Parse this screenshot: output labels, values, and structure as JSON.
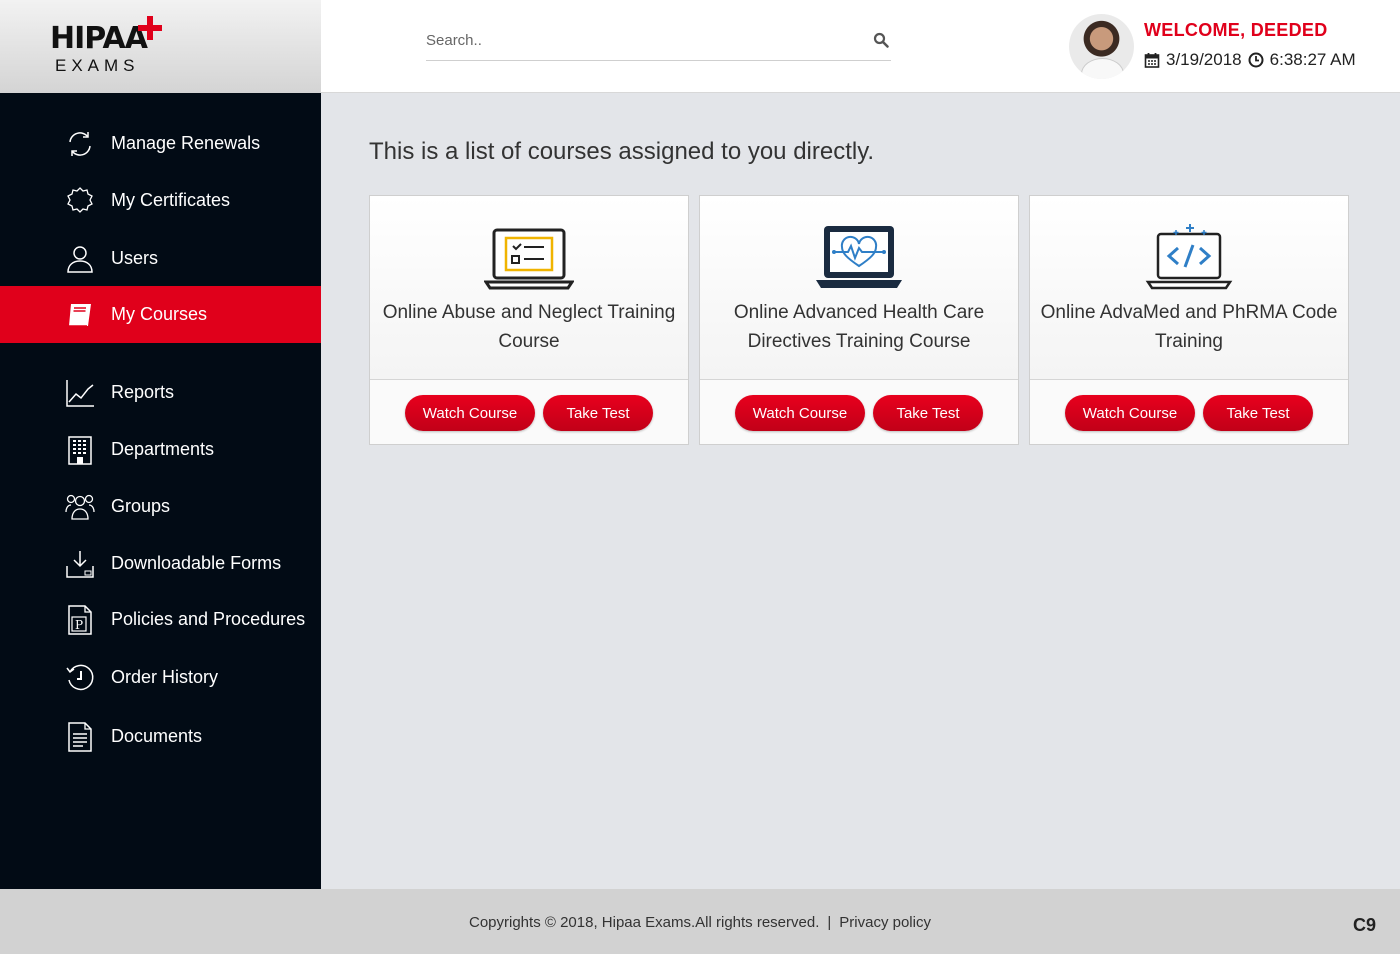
{
  "brand": {
    "name_top": "HIPAA",
    "name_bottom": "EXAMS",
    "accent": "#e0001b"
  },
  "search": {
    "placeholder": "Search.."
  },
  "user": {
    "welcome": "WELCOME, DEEDED",
    "date": "3/19/2018",
    "time": "6:38:27 AM"
  },
  "sidebar": {
    "items": [
      {
        "label": "Manage Renewals",
        "icon": "refresh-icon"
      },
      {
        "label": "My Certificates",
        "icon": "certificate-icon"
      },
      {
        "label": "Users",
        "icon": "user-icon"
      },
      {
        "label": "My Courses",
        "icon": "book-icon",
        "active": true
      },
      {
        "label": "Reports",
        "icon": "chart-icon"
      },
      {
        "label": "Departments",
        "icon": "building-icon"
      },
      {
        "label": "Groups",
        "icon": "group-icon"
      },
      {
        "label": "Downloadable Forms",
        "icon": "download-icon"
      },
      {
        "label": "Policies and Procedures",
        "icon": "policy-document-icon"
      },
      {
        "label": "Order History",
        "icon": "history-icon"
      },
      {
        "label": "Documents",
        "icon": "document-icon"
      }
    ]
  },
  "main": {
    "title": "This is a list of courses assigned to you directly.",
    "courses": [
      {
        "title": "Online Abuse and Neglect Training Course",
        "icon": "laptop-checklist-icon",
        "watch_label": "Watch Course",
        "test_label": "Take Test"
      },
      {
        "title": "Online Advanced Health Care Directives Training Course",
        "icon": "laptop-heartbeat-icon",
        "watch_label": "Watch Course",
        "test_label": "Take Test"
      },
      {
        "title": "Online AdvaMed and PhRMA Code Training",
        "icon": "laptop-code-icon",
        "watch_label": "Watch Course",
        "test_label": "Take Test"
      }
    ]
  },
  "footer": {
    "copyright": "Copyrights © 2018, Hipaa Exams.All rights reserved.",
    "separator": "|",
    "privacy": "Privacy policy",
    "badge": "C9"
  }
}
